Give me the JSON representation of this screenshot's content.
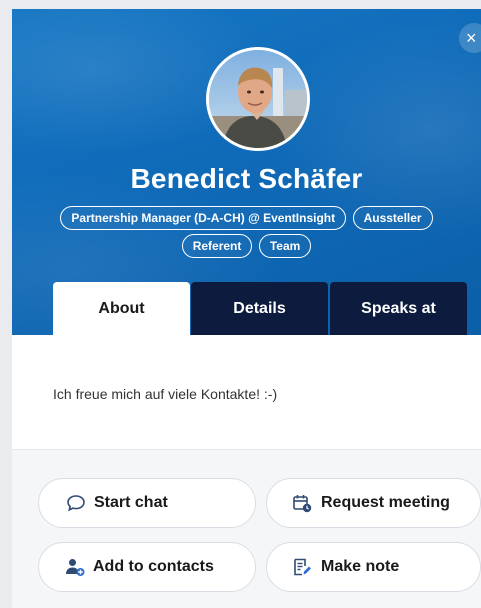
{
  "close_glyph": "×",
  "profile": {
    "name": "Benedict Schäfer",
    "badges_row1": [
      "Partnership Manager (D-A-CH) @ EventInsight",
      "Aussteller"
    ],
    "badges_row2": [
      "Referent",
      "Team"
    ]
  },
  "tabs": [
    {
      "label": "About",
      "active": true
    },
    {
      "label": "Details",
      "active": false
    },
    {
      "label": "Speaks at",
      "active": false
    }
  ],
  "about_text": "Ich freue mich auf viele Kontakte! :-)",
  "actions": {
    "start_chat": "Start chat",
    "request_meeting": "Request meeting",
    "add_to_contacts": "Add to contacts",
    "make_note": "Make note"
  },
  "colors": {
    "hero": "#1270bd",
    "tab_dark": "#0d1b3e",
    "icon": "#2f4a73"
  }
}
